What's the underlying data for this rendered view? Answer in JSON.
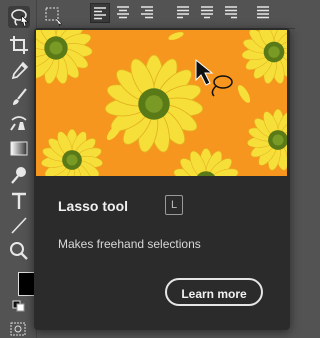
{
  "tooltip": {
    "title": "Lasso tool",
    "shortcut": "L",
    "description": "Makes freehand selections",
    "learn_more_label": "Learn more"
  },
  "toolbar": {
    "tools": [
      "lasso-icon",
      "crop-icon",
      "eyedropper-icon",
      "brush-icon",
      "clone-stamp-icon",
      "gradient-icon",
      "dodge-icon",
      "type-icon",
      "line-icon",
      "zoom-icon"
    ],
    "active_tool": "lasso-icon"
  },
  "options_bar": {
    "align_buttons": [
      "align-left-icon",
      "align-center-icon",
      "align-right-icon",
      "justify-last-left-icon",
      "justify-last-center-icon",
      "justify-last-right-icon",
      "justify-all-icon"
    ],
    "active_align": "align-left-icon"
  },
  "colors": {
    "panel_bg": "#2b2b2b",
    "ui_bg": "#535353",
    "preview_bg": "#f7961e",
    "flower_petal": "#f7df3a",
    "flower_center": "#5a7a18"
  }
}
